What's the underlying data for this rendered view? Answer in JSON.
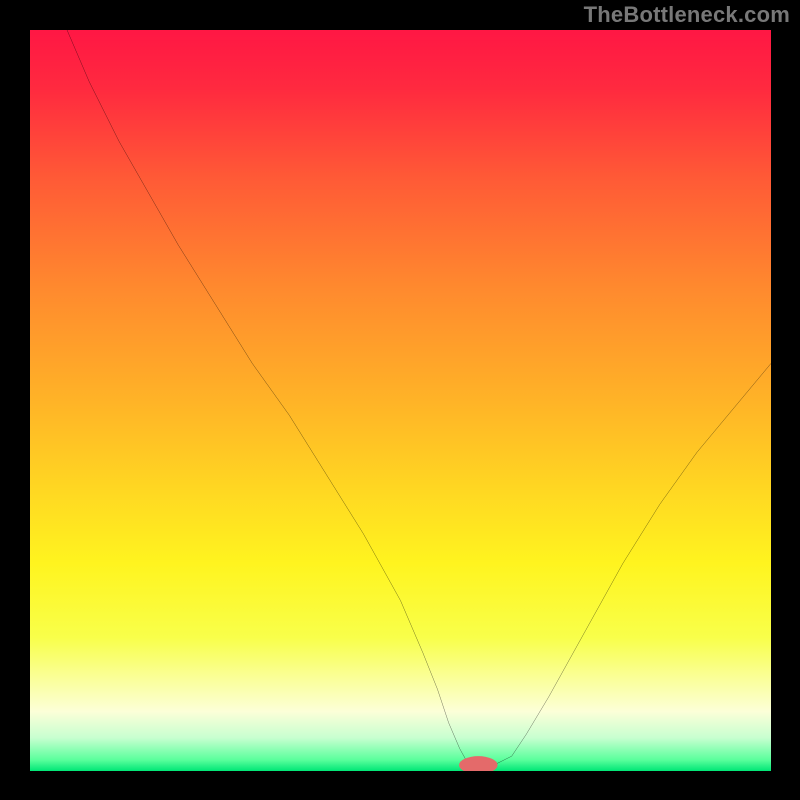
{
  "watermark": "TheBottleneck.com",
  "chart_data": {
    "type": "line",
    "title": "",
    "xlabel": "",
    "ylabel": "",
    "xlim": [
      0,
      100
    ],
    "ylim": [
      0,
      100
    ],
    "gradient_stops": [
      {
        "offset": 0.0,
        "color": "#ff1744"
      },
      {
        "offset": 0.08,
        "color": "#ff2a3f"
      },
      {
        "offset": 0.2,
        "color": "#ff5a36"
      },
      {
        "offset": 0.35,
        "color": "#ff8a2e"
      },
      {
        "offset": 0.5,
        "color": "#ffb327"
      },
      {
        "offset": 0.62,
        "color": "#ffd722"
      },
      {
        "offset": 0.72,
        "color": "#fff41f"
      },
      {
        "offset": 0.82,
        "color": "#f8ff4a"
      },
      {
        "offset": 0.88,
        "color": "#faffa0"
      },
      {
        "offset": 0.92,
        "color": "#fcffd8"
      },
      {
        "offset": 0.955,
        "color": "#c8ffd0"
      },
      {
        "offset": 0.985,
        "color": "#5aff9c"
      },
      {
        "offset": 1.0,
        "color": "#00e676"
      }
    ],
    "curve": {
      "x": [
        5,
        8,
        12,
        16,
        20,
        25,
        30,
        35,
        40,
        45,
        50,
        53,
        55,
        56.5,
        58,
        59,
        60,
        62,
        65,
        67,
        70,
        75,
        80,
        85,
        90,
        95,
        100
      ],
      "y": [
        100,
        93,
        85,
        78,
        71,
        63,
        55,
        48,
        40,
        32,
        23,
        16,
        11,
        6.5,
        3,
        1.2,
        0.5,
        0.5,
        2,
        5,
        10,
        19,
        28,
        36,
        43,
        49,
        55
      ]
    },
    "flat_segment": {
      "x0": 58.5,
      "x1": 62.5,
      "y": 0.5
    },
    "marker": {
      "x": 60.5,
      "y": 0.8,
      "color": "#e46a6a",
      "rx": 2.6,
      "ry": 1.2
    }
  }
}
